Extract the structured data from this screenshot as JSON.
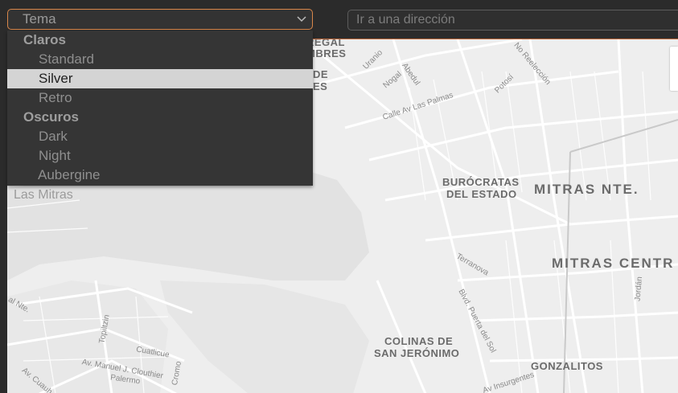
{
  "toolbar": {
    "theme_select_value": "Tema",
    "address_placeholder": "Ir a una dirección"
  },
  "dropdown": {
    "groups": [
      {
        "label": "Claros",
        "items": [
          "Standard",
          "Silver",
          "Retro"
        ]
      },
      {
        "label": "Oscuros",
        "items": [
          "Dark",
          "Night",
          "Aubergine"
        ]
      }
    ],
    "selected": "Silver"
  },
  "map": {
    "districts": {
      "burocratas_line1": "BURÓCRATAS",
      "burocratas_line2": "DEL ESTADO",
      "mitras_nte": "MITRAS NTE.",
      "mitras_centro": "MITRAS CENTR",
      "colinas_line1": "COLINAS DE",
      "colinas_line2": "SAN JERÓNIMO",
      "gonzalitos": "GONZALITOS",
      "las_mitras": "Las Mitras",
      "regal_partial": "REGAL",
      "mbres_partial": "MBRES",
      "de_partial": "DE",
      "es_partial": "ES"
    },
    "streets": {
      "uranio": "Uranio",
      "nogal": "Nogal",
      "abedul": "Abedul",
      "no_reeleccion": "No Reelección",
      "potosi": "Potosí",
      "calle_av_las_palmas": "Calle Av Las Palmas",
      "terranova": "Terranova",
      "blvd_puerta_del_sol": "Blvd. Puerta del Sol",
      "jordan": "Jordán",
      "topiltzin": "Topiltzin",
      "cuatlicue": "Cuatlicue",
      "av_manuel_j_clouthier": "Av. Manuel J. Clouthier",
      "palermo": "Palermo",
      "cromo": "Cromo",
      "av_insurgentes": "Av Insurgentes",
      "av_cuauh": "Av. Cuauh",
      "al_nte": "al Nte."
    }
  },
  "colors": {
    "accent": "#d9874a",
    "background": "#2b2b2b",
    "map_land": "#eeeeee",
    "map_road": "#ffffff",
    "dropdown_bg": "#353535",
    "selected_bg": "#d4d4d4"
  }
}
